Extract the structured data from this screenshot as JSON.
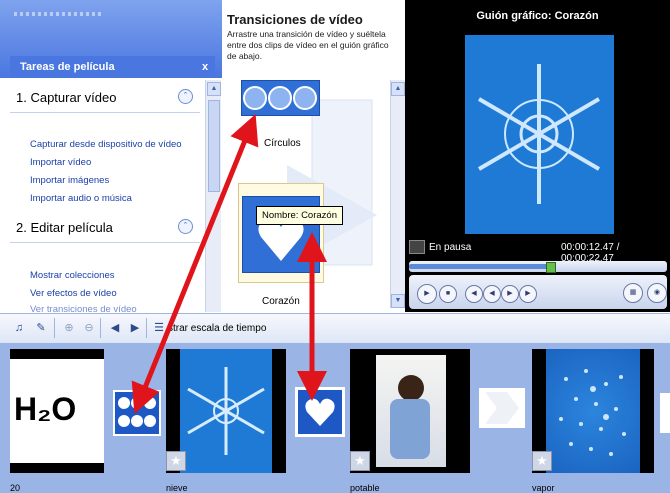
{
  "tasks_panel": {
    "header": "Tareas de película",
    "close_label": "x",
    "sections": [
      {
        "title": "1. Capturar vídeo",
        "links": [
          "Capturar desde dispositivo de vídeo",
          "Importar vídeo",
          "Importar imágenes",
          "Importar audio o música"
        ]
      },
      {
        "title": "2. Editar película",
        "links": [
          "Mostrar colecciones",
          "Ver efectos de vídeo",
          "Ver transiciones de vídeo"
        ]
      }
    ]
  },
  "transitions_panel": {
    "title": "Transiciones de vídeo",
    "description": "Arrastre una transición de vídeo y suéltela entre dos clips de vídeo en el guión gráfico de abajo.",
    "items": [
      {
        "label": "Círculos"
      },
      {
        "label": "Corazón"
      }
    ],
    "tooltip": "Nombre: Corazón"
  },
  "storyboard": {
    "title": "Guión gráfico: Corazón",
    "status": "En pausa",
    "time": "00:00:12.47 / 00:00:22.47",
    "progress": 0.55
  },
  "toolbar": {
    "timeline_label": "strar escala de tiempo"
  },
  "timeline": {
    "clips": [
      {
        "label": "20",
        "content": "H₂O"
      },
      {
        "label": "nieve"
      },
      {
        "label": "potable"
      },
      {
        "label": "vapor"
      }
    ]
  },
  "colors": {
    "accent": "#4a76e0",
    "annotation_arrow": "#e0141b",
    "strip_bg": "#9ab4e6"
  }
}
